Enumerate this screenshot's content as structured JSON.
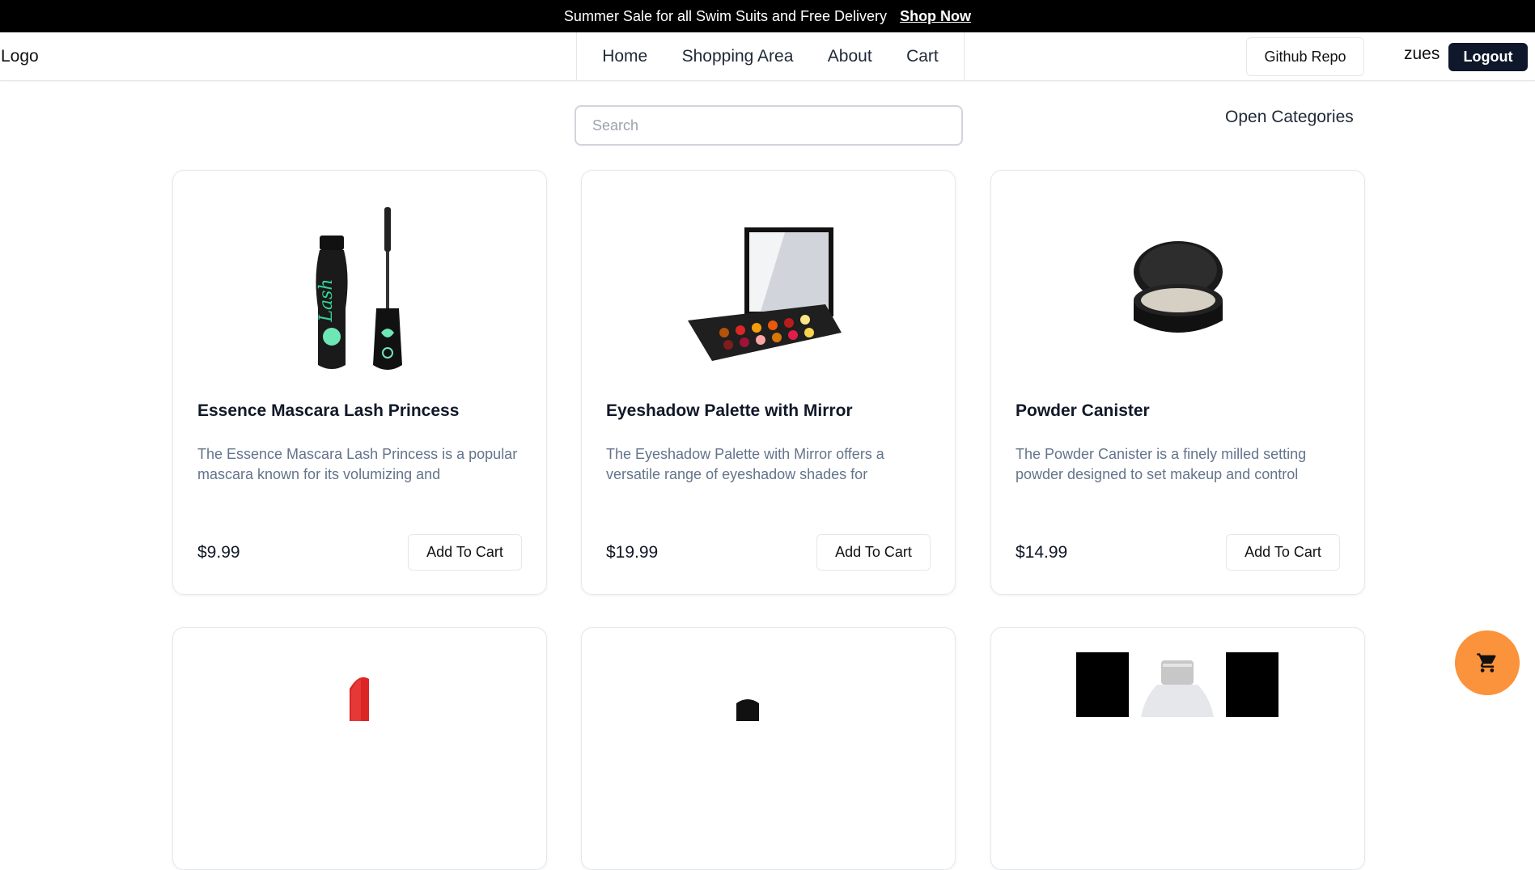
{
  "promo": {
    "text": "Summer Sale for all Swim Suits and Free Delivery",
    "link": "Shop Now"
  },
  "navbar": {
    "logo": "Logo",
    "links": [
      "Home",
      "Shopping Area",
      "About",
      "Cart"
    ],
    "github_button": "Github Repo",
    "username": "zues",
    "logout_button": "Logout"
  },
  "search": {
    "placeholder": "Search",
    "value": ""
  },
  "categories_toggle": "Open Categories",
  "products": [
    {
      "title": "Essence Mascara Lash Princess",
      "description": "The Essence Mascara Lash Princess is a popular mascara known for its volumizing and",
      "price": "$9.99",
      "button": "Add To Cart",
      "image_icon": "mascara-image"
    },
    {
      "title": "Eyeshadow Palette with Mirror",
      "description": "The Eyeshadow Palette with Mirror offers a versatile range of eyeshadow shades for",
      "price": "$19.99",
      "button": "Add To Cart",
      "image_icon": "eyeshadow-palette-image"
    },
    {
      "title": "Powder Canister",
      "description": "The Powder Canister is a finely milled setting powder designed to set makeup and control",
      "price": "$14.99",
      "button": "Add To Cart",
      "image_icon": "powder-canister-image"
    }
  ],
  "partial_products": [
    {
      "image_icon": "lipstick-image"
    },
    {
      "image_icon": "nail-polish-image"
    },
    {
      "image_icon": "perfume-bottle-image"
    }
  ],
  "floating_cart": {
    "icon": "cart-icon",
    "color": "#fb923c"
  },
  "colors": {
    "promo_bg": "#000000",
    "logout_bg": "#0f172a",
    "accent": "#fb923c",
    "desc_text": "#64748b"
  }
}
